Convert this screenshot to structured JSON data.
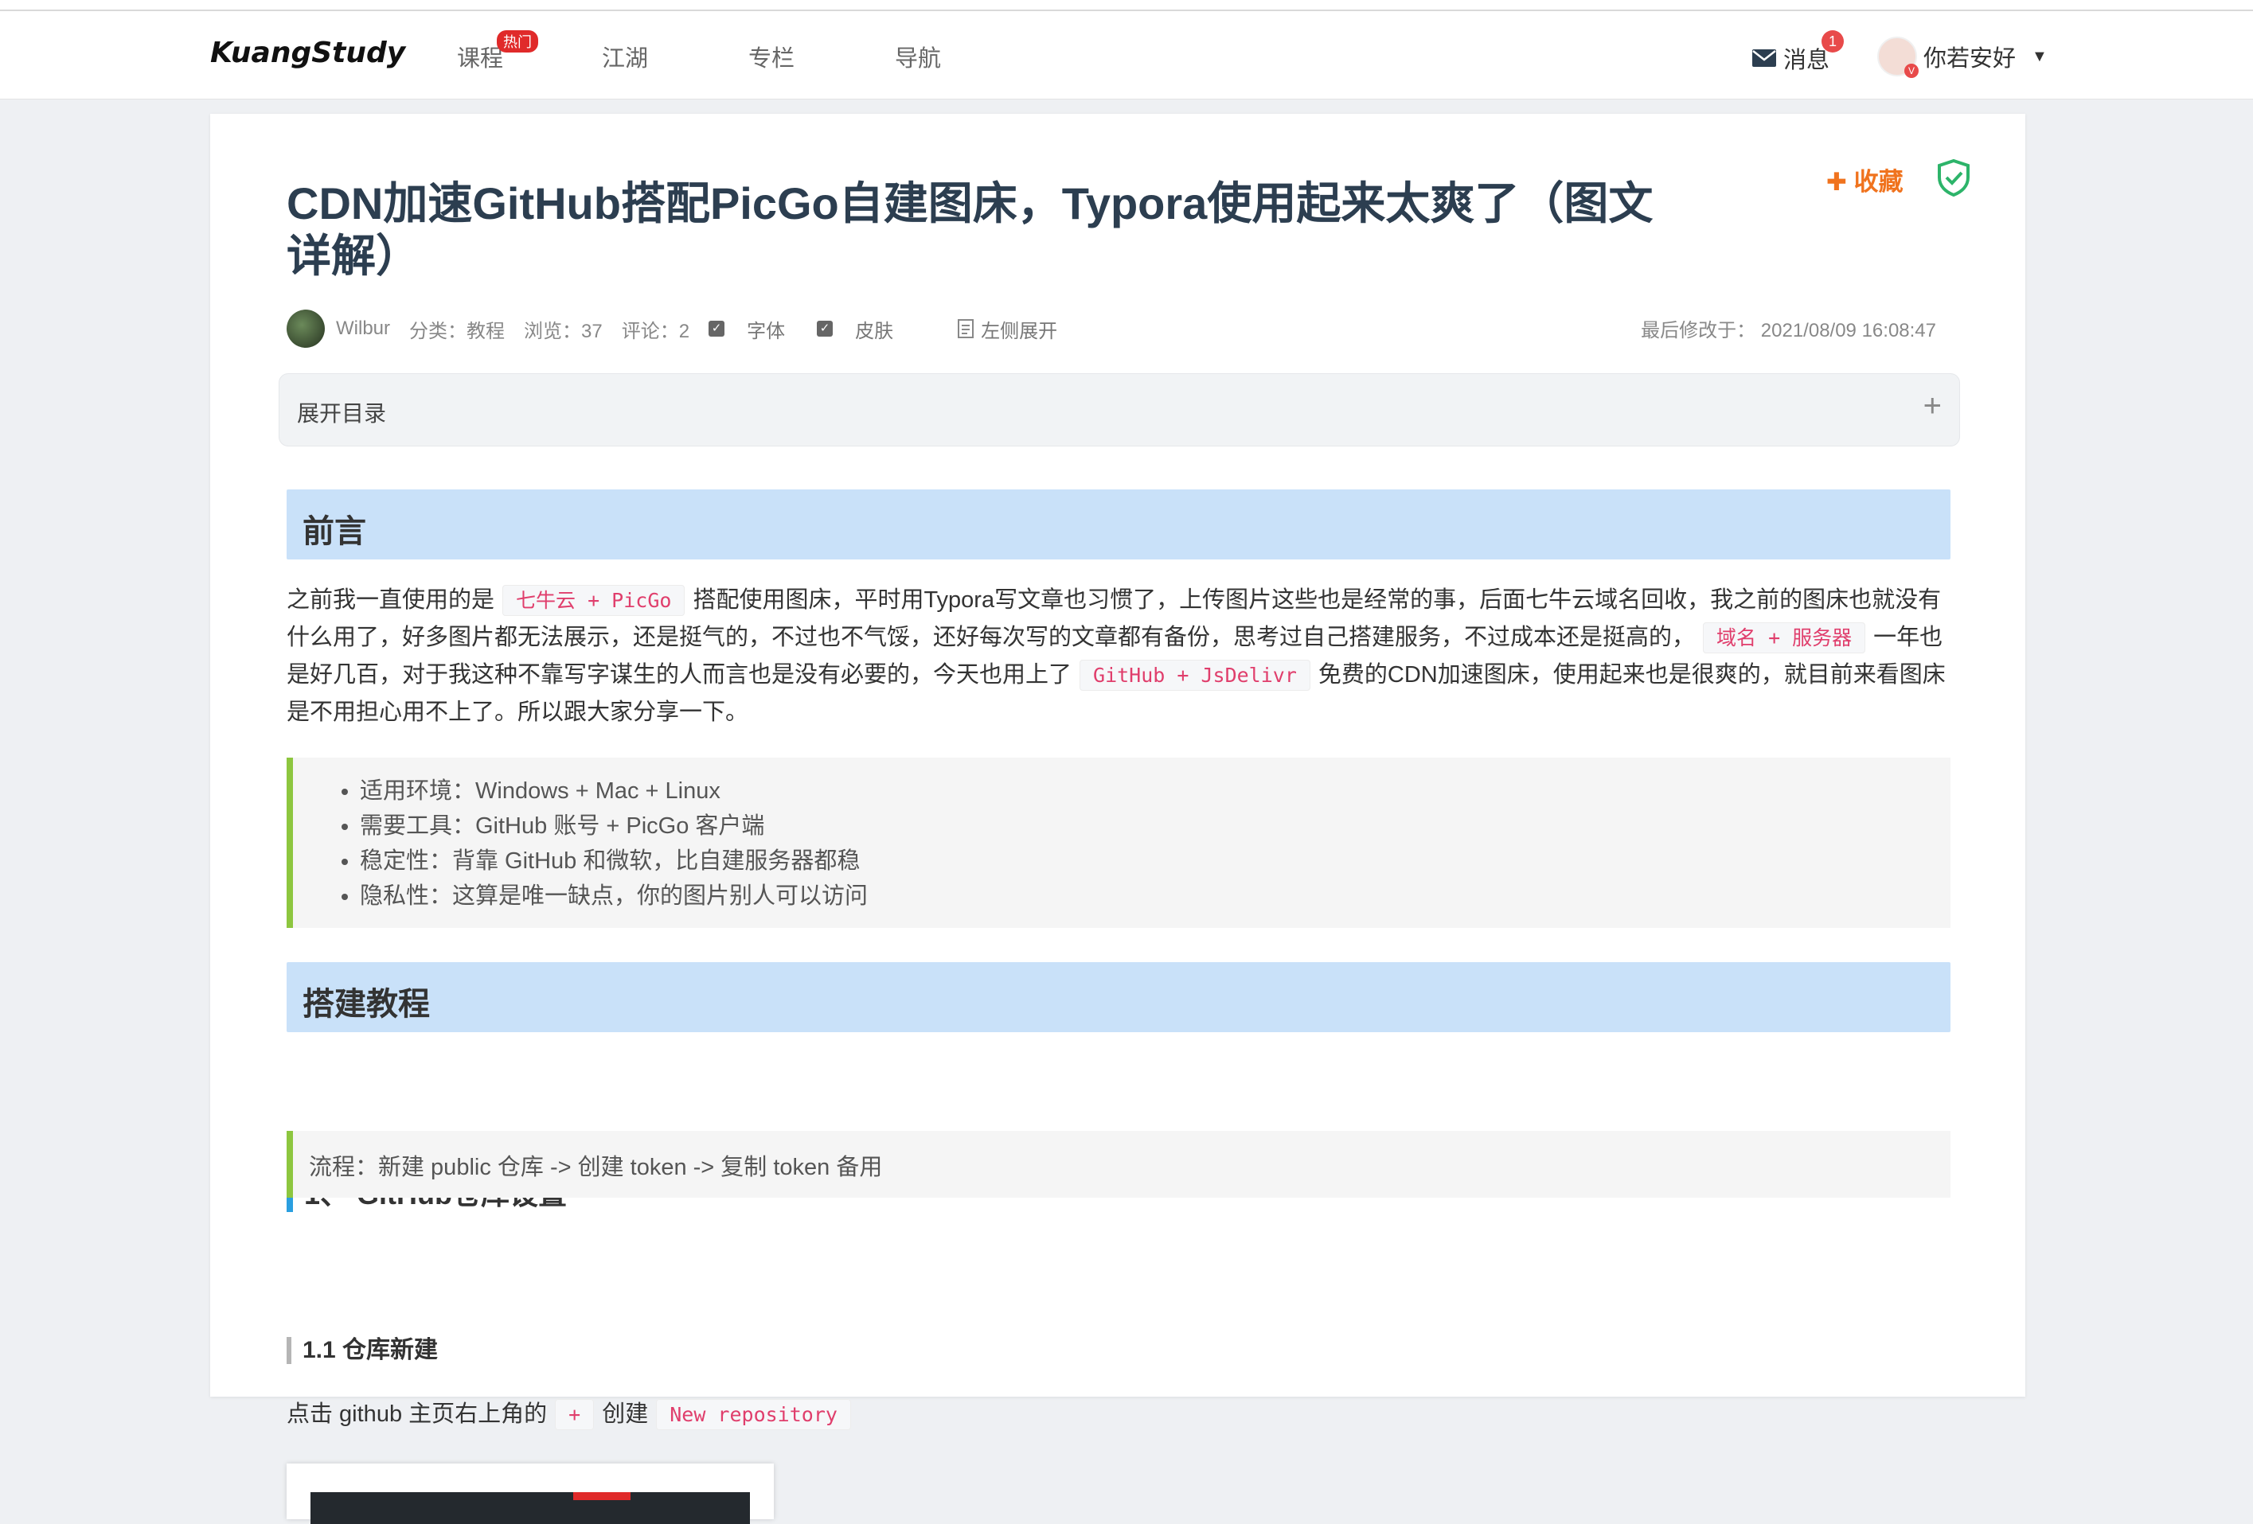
{
  "nav": {
    "logo": "KuangStudy",
    "items": [
      "课程",
      "江湖",
      "专栏",
      "导航"
    ],
    "hot_badge": "热门",
    "messages_label": "消息",
    "messages_count": "1",
    "user_name": "你若安好",
    "avatar_badge": "V"
  },
  "article": {
    "title": "CDN加速GitHub搭配PicGo自建图床，Typora使用起来太爽了（图文详解）",
    "favorite": "收藏",
    "author": "Wilbur",
    "category": "分类：教程",
    "views": "浏览：37",
    "comments": "评论：2",
    "font_toggle": "字体",
    "skin_toggle": "皮肤",
    "expand_left": "左侧展开",
    "modified": "最后修改于：  2021/08/09 16:08:47",
    "toc_label": "展开目录",
    "toc_plus": "+"
  },
  "content": {
    "h2_preface": "前言",
    "p1_a": "之前我一直使用的是",
    "code1": "七牛云 + PicGo",
    "p1_b": "搭配使用图床，平时用Typora写文章也习惯了，上传图片这些也是经常的事，后面七牛云域名回收，我之前的图床也就没有什么用了，好多图片都无法展示，还是挺气的，不过也不气馁，还好每次写的文章都有备份，思考过自己搭建服务，不过成本还是挺高的，",
    "code2": "域名 + 服务器",
    "p1_c": "一年也是好几百，对于我这种不靠写字谋生的人而言也是没有必要的，今天也用上了",
    "code3": "GitHub + JsDelivr",
    "p1_d": "免费的CDN加速图床，使用起来也是很爽的，就目前来看图床是不用担心用不上了。所以跟大家分享一下。",
    "bullets": [
      "适用环境：Windows + Mac + Linux",
      "需要工具：GitHub 账号 + PicGo 客户端",
      "稳定性：背靠 GitHub 和微软，比自建服务器都稳",
      "隐私性：这算是唯一缺点，你的图片别人可以访问"
    ],
    "h2_build": "搭建教程",
    "h3_repo": "1、 GitHub仓库设置",
    "flow": "流程：新建 public 仓库 -> 创建 token -> 复制 token 备用",
    "h4_new": "1.1 仓库新建",
    "line5_a": "点击 github 主页右上角的",
    "code4": "+",
    "line5_b": "创建",
    "code5": "New repository"
  }
}
